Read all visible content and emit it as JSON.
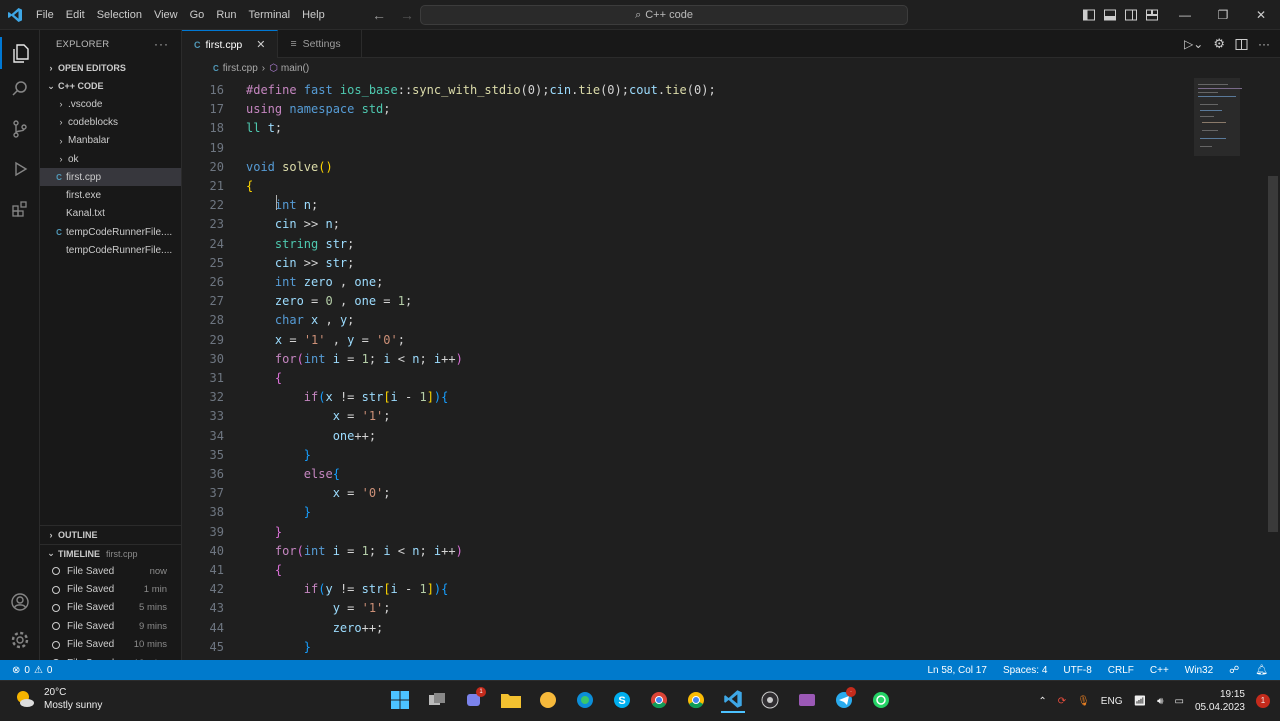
{
  "titlebar": {
    "menu": [
      "File",
      "Edit",
      "Selection",
      "View",
      "Go",
      "Run",
      "Terminal",
      "Help"
    ],
    "command_center": "C++ code"
  },
  "sidebar": {
    "header": "EXPLORER",
    "open_editors": "OPEN EDITORS",
    "workspace": "C++ CODE",
    "items": [
      {
        "label": ".vscode",
        "type": "folder"
      },
      {
        "label": "codeblocks",
        "type": "folder"
      },
      {
        "label": "Manbalar",
        "type": "folder"
      },
      {
        "label": "ok",
        "type": "folder"
      },
      {
        "label": "first.cpp",
        "type": "cpp",
        "selected": true
      },
      {
        "label": "first.exe",
        "type": "file"
      },
      {
        "label": "Kanal.txt",
        "type": "file"
      },
      {
        "label": "tempCodeRunnerFile....",
        "type": "cpp"
      },
      {
        "label": "tempCodeRunnerFile....",
        "type": "file"
      }
    ],
    "outline": "OUTLINE",
    "timeline": "TIMELINE",
    "timeline_file": "first.cpp",
    "timeline_items": [
      {
        "label": "File Saved",
        "time": "now"
      },
      {
        "label": "File Saved",
        "time": "1 min"
      },
      {
        "label": "File Saved",
        "time": "5 mins"
      },
      {
        "label": "File Saved",
        "time": "9 mins"
      },
      {
        "label": "File Saved",
        "time": "10 mins"
      },
      {
        "label": "File Saved",
        "time": "12 mins"
      }
    ]
  },
  "tabs": [
    {
      "label": "first.cpp",
      "active": true,
      "icon": "C"
    },
    {
      "label": "Settings",
      "active": false,
      "icon": "≡"
    }
  ],
  "breadcrumb": {
    "file": "first.cpp",
    "symbol": "main()"
  },
  "editor": {
    "lines": [
      {
        "n": "16",
        "segs": [
          [
            "#define ",
            "#c586c0"
          ],
          [
            "fast ",
            "#569cd6"
          ],
          [
            "ios_base",
            "#4ec9b0"
          ],
          [
            "::",
            "#d4d4d4"
          ],
          [
            "sync_with_stdio",
            "#dcdcaa"
          ],
          [
            "(0);",
            "#d4d4d4"
          ],
          [
            "cin",
            "#9cdcfe"
          ],
          [
            ".",
            "#d4d4d4"
          ],
          [
            "tie",
            "#dcdcaa"
          ],
          [
            "(0);",
            "#d4d4d4"
          ],
          [
            "cout",
            "#9cdcfe"
          ],
          [
            ".",
            "#d4d4d4"
          ],
          [
            "tie",
            "#dcdcaa"
          ],
          [
            "(0);",
            "#d4d4d4"
          ]
        ]
      },
      {
        "n": "17",
        "segs": [
          [
            "using ",
            "#c586c0"
          ],
          [
            "namespace ",
            "#569cd6"
          ],
          [
            "std",
            "#4ec9b0"
          ],
          [
            ";",
            "#d4d4d4"
          ]
        ]
      },
      {
        "n": "18",
        "segs": [
          [
            "ll ",
            "#4ec9b0"
          ],
          [
            "t",
            "#9cdcfe"
          ],
          [
            ";",
            "#d4d4d4"
          ]
        ]
      },
      {
        "n": "19",
        "segs": []
      },
      {
        "n": "20",
        "segs": [
          [
            "void ",
            "#569cd6"
          ],
          [
            "solve",
            "#dcdcaa"
          ],
          [
            "()",
            "#ffd700"
          ]
        ]
      },
      {
        "n": "21",
        "segs": [
          [
            "{",
            "#ffd700"
          ]
        ]
      },
      {
        "n": "22",
        "segs": [
          [
            "    int ",
            "#569cd6"
          ],
          [
            "n",
            "#9cdcfe"
          ],
          [
            ";",
            "#d4d4d4"
          ]
        ]
      },
      {
        "n": "23",
        "segs": [
          [
            "    cin ",
            "#9cdcfe"
          ],
          [
            ">> ",
            "#d4d4d4"
          ],
          [
            "n",
            "#9cdcfe"
          ],
          [
            ";",
            "#d4d4d4"
          ]
        ]
      },
      {
        "n": "24",
        "segs": [
          [
            "    string ",
            "#4ec9b0"
          ],
          [
            "str",
            "#9cdcfe"
          ],
          [
            ";",
            "#d4d4d4"
          ]
        ]
      },
      {
        "n": "25",
        "segs": [
          [
            "    cin ",
            "#9cdcfe"
          ],
          [
            ">> ",
            "#d4d4d4"
          ],
          [
            "str",
            "#9cdcfe"
          ],
          [
            ";",
            "#d4d4d4"
          ]
        ]
      },
      {
        "n": "26",
        "segs": [
          [
            "    int ",
            "#569cd6"
          ],
          [
            "zero ",
            "#9cdcfe"
          ],
          [
            ", ",
            "#d4d4d4"
          ],
          [
            "one",
            "#9cdcfe"
          ],
          [
            ";",
            "#d4d4d4"
          ]
        ]
      },
      {
        "n": "27",
        "segs": [
          [
            "    zero ",
            "#9cdcfe"
          ],
          [
            "= ",
            "#d4d4d4"
          ],
          [
            "0 ",
            "#b5cea8"
          ],
          [
            ", ",
            "#d4d4d4"
          ],
          [
            "one ",
            "#9cdcfe"
          ],
          [
            "= ",
            "#d4d4d4"
          ],
          [
            "1",
            "#b5cea8"
          ],
          [
            ";",
            "#d4d4d4"
          ]
        ]
      },
      {
        "n": "28",
        "segs": [
          [
            "    char ",
            "#569cd6"
          ],
          [
            "x ",
            "#9cdcfe"
          ],
          [
            ", ",
            "#d4d4d4"
          ],
          [
            "y",
            "#9cdcfe"
          ],
          [
            ";",
            "#d4d4d4"
          ]
        ]
      },
      {
        "n": "29",
        "segs": [
          [
            "    x ",
            "#9cdcfe"
          ],
          [
            "= ",
            "#d4d4d4"
          ],
          [
            "'1' ",
            "#ce9178"
          ],
          [
            ", ",
            "#d4d4d4"
          ],
          [
            "y ",
            "#9cdcfe"
          ],
          [
            "= ",
            "#d4d4d4"
          ],
          [
            "'0'",
            "#ce9178"
          ],
          [
            ";",
            "#d4d4d4"
          ]
        ]
      },
      {
        "n": "30",
        "segs": [
          [
            "    for",
            "#c586c0"
          ],
          [
            "(",
            "#da70d6"
          ],
          [
            "int ",
            "#569cd6"
          ],
          [
            "i ",
            "#9cdcfe"
          ],
          [
            "= ",
            "#d4d4d4"
          ],
          [
            "1",
            "#b5cea8"
          ],
          [
            "; ",
            "#d4d4d4"
          ],
          [
            "i ",
            "#9cdcfe"
          ],
          [
            "< ",
            "#d4d4d4"
          ],
          [
            "n",
            "#9cdcfe"
          ],
          [
            "; ",
            "#d4d4d4"
          ],
          [
            "i",
            "#9cdcfe"
          ],
          [
            "++",
            "#d4d4d4"
          ],
          [
            ")",
            "#da70d6"
          ]
        ]
      },
      {
        "n": "31",
        "segs": [
          [
            "    {",
            "#da70d6"
          ]
        ]
      },
      {
        "n": "32",
        "segs": [
          [
            "        if",
            "#c586c0"
          ],
          [
            "(",
            "#179fff"
          ],
          [
            "x ",
            "#9cdcfe"
          ],
          [
            "!= ",
            "#d4d4d4"
          ],
          [
            "str",
            "#9cdcfe"
          ],
          [
            "[",
            "#ffd700"
          ],
          [
            "i ",
            "#9cdcfe"
          ],
          [
            "- ",
            "#d4d4d4"
          ],
          [
            "1",
            "#b5cea8"
          ],
          [
            "]",
            "#ffd700"
          ],
          [
            ")",
            "#179fff"
          ],
          [
            "{",
            "#179fff"
          ]
        ]
      },
      {
        "n": "33",
        "segs": [
          [
            "            x ",
            "#9cdcfe"
          ],
          [
            "= ",
            "#d4d4d4"
          ],
          [
            "'1'",
            "#ce9178"
          ],
          [
            ";",
            "#d4d4d4"
          ]
        ]
      },
      {
        "n": "34",
        "segs": [
          [
            "            one",
            "#9cdcfe"
          ],
          [
            "++;",
            "#d4d4d4"
          ]
        ]
      },
      {
        "n": "35",
        "segs": [
          [
            "        }",
            "#179fff"
          ]
        ]
      },
      {
        "n": "36",
        "segs": [
          [
            "        else",
            "#c586c0"
          ],
          [
            "{",
            "#179fff"
          ]
        ]
      },
      {
        "n": "37",
        "segs": [
          [
            "            x ",
            "#9cdcfe"
          ],
          [
            "= ",
            "#d4d4d4"
          ],
          [
            "'0'",
            "#ce9178"
          ],
          [
            ";",
            "#d4d4d4"
          ]
        ]
      },
      {
        "n": "38",
        "segs": [
          [
            "        }",
            "#179fff"
          ]
        ]
      },
      {
        "n": "39",
        "segs": [
          [
            "    }",
            "#da70d6"
          ]
        ]
      },
      {
        "n": "40",
        "segs": [
          [
            "    for",
            "#c586c0"
          ],
          [
            "(",
            "#da70d6"
          ],
          [
            "int ",
            "#569cd6"
          ],
          [
            "i ",
            "#9cdcfe"
          ],
          [
            "= ",
            "#d4d4d4"
          ],
          [
            "1",
            "#b5cea8"
          ],
          [
            "; ",
            "#d4d4d4"
          ],
          [
            "i ",
            "#9cdcfe"
          ],
          [
            "< ",
            "#d4d4d4"
          ],
          [
            "n",
            "#9cdcfe"
          ],
          [
            "; ",
            "#d4d4d4"
          ],
          [
            "i",
            "#9cdcfe"
          ],
          [
            "++",
            "#d4d4d4"
          ],
          [
            ")",
            "#da70d6"
          ]
        ]
      },
      {
        "n": "41",
        "segs": [
          [
            "    {",
            "#da70d6"
          ]
        ]
      },
      {
        "n": "42",
        "segs": [
          [
            "        if",
            "#c586c0"
          ],
          [
            "(",
            "#179fff"
          ],
          [
            "y ",
            "#9cdcfe"
          ],
          [
            "!= ",
            "#d4d4d4"
          ],
          [
            "str",
            "#9cdcfe"
          ],
          [
            "[",
            "#ffd700"
          ],
          [
            "i ",
            "#9cdcfe"
          ],
          [
            "- ",
            "#d4d4d4"
          ],
          [
            "1",
            "#b5cea8"
          ],
          [
            "]",
            "#ffd700"
          ],
          [
            ")",
            "#179fff"
          ],
          [
            "{",
            "#179fff"
          ]
        ]
      },
      {
        "n": "43",
        "segs": [
          [
            "            y ",
            "#9cdcfe"
          ],
          [
            "= ",
            "#d4d4d4"
          ],
          [
            "'1'",
            "#ce9178"
          ],
          [
            ";",
            "#d4d4d4"
          ]
        ]
      },
      {
        "n": "44",
        "segs": [
          [
            "            zero",
            "#9cdcfe"
          ],
          [
            "++;",
            "#d4d4d4"
          ]
        ]
      },
      {
        "n": "45",
        "segs": [
          [
            "        }",
            "#179fff"
          ]
        ]
      }
    ]
  },
  "statusbar": {
    "errors": "0",
    "warnings": "0",
    "position": "Ln 58, Col 17",
    "spaces": "Spaces: 4",
    "encoding": "UTF-8",
    "eol": "CRLF",
    "language": "C++",
    "platform": "Win32"
  },
  "taskbar": {
    "temperature": "20°C",
    "weather": "Mostly sunny",
    "lang": "ENG",
    "time": "19:15",
    "date": "05.04.2023",
    "notif_count": "1"
  },
  "colors": {
    "accent": "#007acc",
    "bg": "#1f1f1f",
    "sidebar": "#181818"
  }
}
